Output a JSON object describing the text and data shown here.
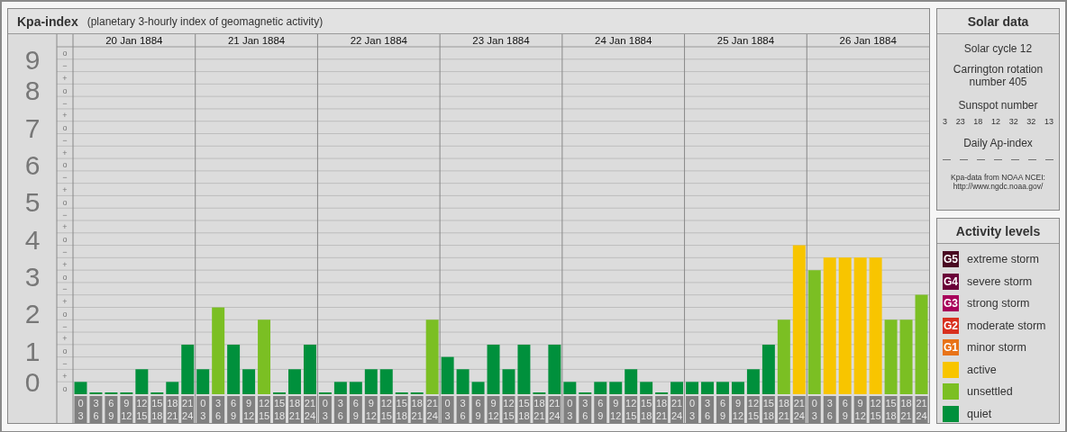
{
  "kpa_panel": {
    "title": "Kpa-index",
    "subtitle": "(planetary 3-hourly index of geomagnetic activity)",
    "dates": [
      "20 Jan 1884",
      "21 Jan 1884",
      "22 Jan 1884",
      "23 Jan 1884",
      "24 Jan 1884",
      "25 Jan 1884",
      "26 Jan 1884"
    ],
    "y_marks": [
      "o",
      "−",
      "+",
      "o",
      "−",
      "+",
      "o",
      "−",
      "+",
      "o",
      "−",
      "+",
      "o",
      "−",
      "+",
      "o",
      "−",
      "+",
      "o",
      "−",
      "+",
      "o",
      "−",
      "+",
      "o",
      "−",
      "+",
      "o"
    ],
    "chart_data": {
      "type": "bar",
      "grid": true,
      "ylim": [
        0,
        9.33
      ],
      "yticks": [
        0,
        1,
        2,
        3,
        4,
        5,
        6,
        7,
        8,
        9
      ],
      "categories": [
        "0 3",
        "3 6",
        "6 9",
        "9 12",
        "12 15",
        "15 18",
        "18 21",
        "21 24",
        "0 3",
        "3 6",
        "6 9",
        "9 12",
        "12 15",
        "15 18",
        "18 21",
        "21 24",
        "0 3",
        "3 6",
        "6 9",
        "9 12",
        "12 15",
        "15 18",
        "18 21",
        "21 24",
        "0 3",
        "3 6",
        "6 9",
        "9 12",
        "12 15",
        "15 18",
        "18 21",
        "21 24",
        "0 3",
        "3 6",
        "6 9",
        "9 12",
        "12 15",
        "15 18",
        "18 21",
        "21 24",
        "0 3",
        "3 6",
        "6 9",
        "9 12",
        "12 15",
        "15 18",
        "18 21",
        "21 24",
        "0 3",
        "3 6",
        "6 9",
        "9 12",
        "12 15",
        "15 18",
        "18 21",
        "21 24"
      ],
      "series": [
        {
          "color": "#00903c",
          "values": [
            0.33,
            0,
            0,
            0,
            0.67,
            0,
            0.33,
            1.33,
            0.67,
            null,
            1.33,
            0.67,
            null,
            0,
            0.67,
            1.33,
            0,
            0.33,
            0.33,
            0.67,
            0.67,
            0,
            0,
            null,
            1,
            0.67,
            0.33,
            1.33,
            0.67,
            1.33,
            0,
            1.33,
            0.33,
            0,
            0.33,
            0.33,
            0.67,
            0.33,
            0,
            0.33,
            0.33,
            0.33,
            0.33,
            0.33,
            0.67,
            1.33,
            null,
            null,
            null,
            null,
            null,
            null,
            null,
            null,
            null,
            null
          ]
        },
        {
          "color": "#7bbf23",
          "values": [
            null,
            null,
            null,
            null,
            null,
            null,
            null,
            null,
            null,
            2.33,
            null,
            null,
            2,
            null,
            null,
            null,
            null,
            null,
            null,
            null,
            null,
            null,
            null,
            2,
            null,
            null,
            null,
            null,
            null,
            null,
            null,
            null,
            null,
            null,
            null,
            null,
            null,
            null,
            null,
            null,
            null,
            null,
            null,
            null,
            null,
            null,
            2,
            null,
            3.33,
            null,
            null,
            null,
            null,
            2,
            2,
            2.67
          ]
        },
        {
          "color": "#f8c500",
          "values": [
            null,
            null,
            null,
            null,
            null,
            null,
            null,
            null,
            null,
            null,
            null,
            null,
            null,
            null,
            null,
            null,
            null,
            null,
            null,
            null,
            null,
            null,
            null,
            null,
            null,
            null,
            null,
            null,
            null,
            null,
            null,
            null,
            null,
            null,
            null,
            null,
            null,
            null,
            null,
            null,
            null,
            null,
            null,
            null,
            null,
            null,
            null,
            4,
            null,
            3.67,
            3.67,
            3.67,
            3.67,
            null,
            null,
            null
          ]
        }
      ]
    }
  },
  "solar_data": {
    "title": "Solar data",
    "solar_cycle": "Solar cycle 12",
    "carrington": "Carrington rotation number 405",
    "sunspot_label": "Sunspot number",
    "sunspots": [
      "3",
      "23",
      "18",
      "12",
      "32",
      "32",
      "13"
    ],
    "ap_label": "Daily Ap-index",
    "ap_values": [
      "—",
      "—",
      "—",
      "—",
      "—",
      "—",
      "—"
    ],
    "source": "Kpa-data from NOAA NCEI:",
    "source_url": "http://www.ngdc.noaa.gov/"
  },
  "activity_levels": {
    "title": "Activity levels",
    "levels": [
      {
        "badge": "G5",
        "label": "extreme storm",
        "color": "#4a0a22"
      },
      {
        "badge": "G4",
        "label": "severe storm",
        "color": "#6a0038"
      },
      {
        "badge": "G3",
        "label": "strong storm",
        "color": "#a8005a"
      },
      {
        "badge": "G2",
        "label": "moderate storm",
        "color": "#d8301e"
      },
      {
        "badge": "G1",
        "label": "minor storm",
        "color": "#e87318"
      },
      {
        "label": "active",
        "color": "#f8c500"
      },
      {
        "label": "unsettled",
        "color": "#7bbf23"
      },
      {
        "label": "quiet",
        "color": "#00903c"
      }
    ]
  }
}
